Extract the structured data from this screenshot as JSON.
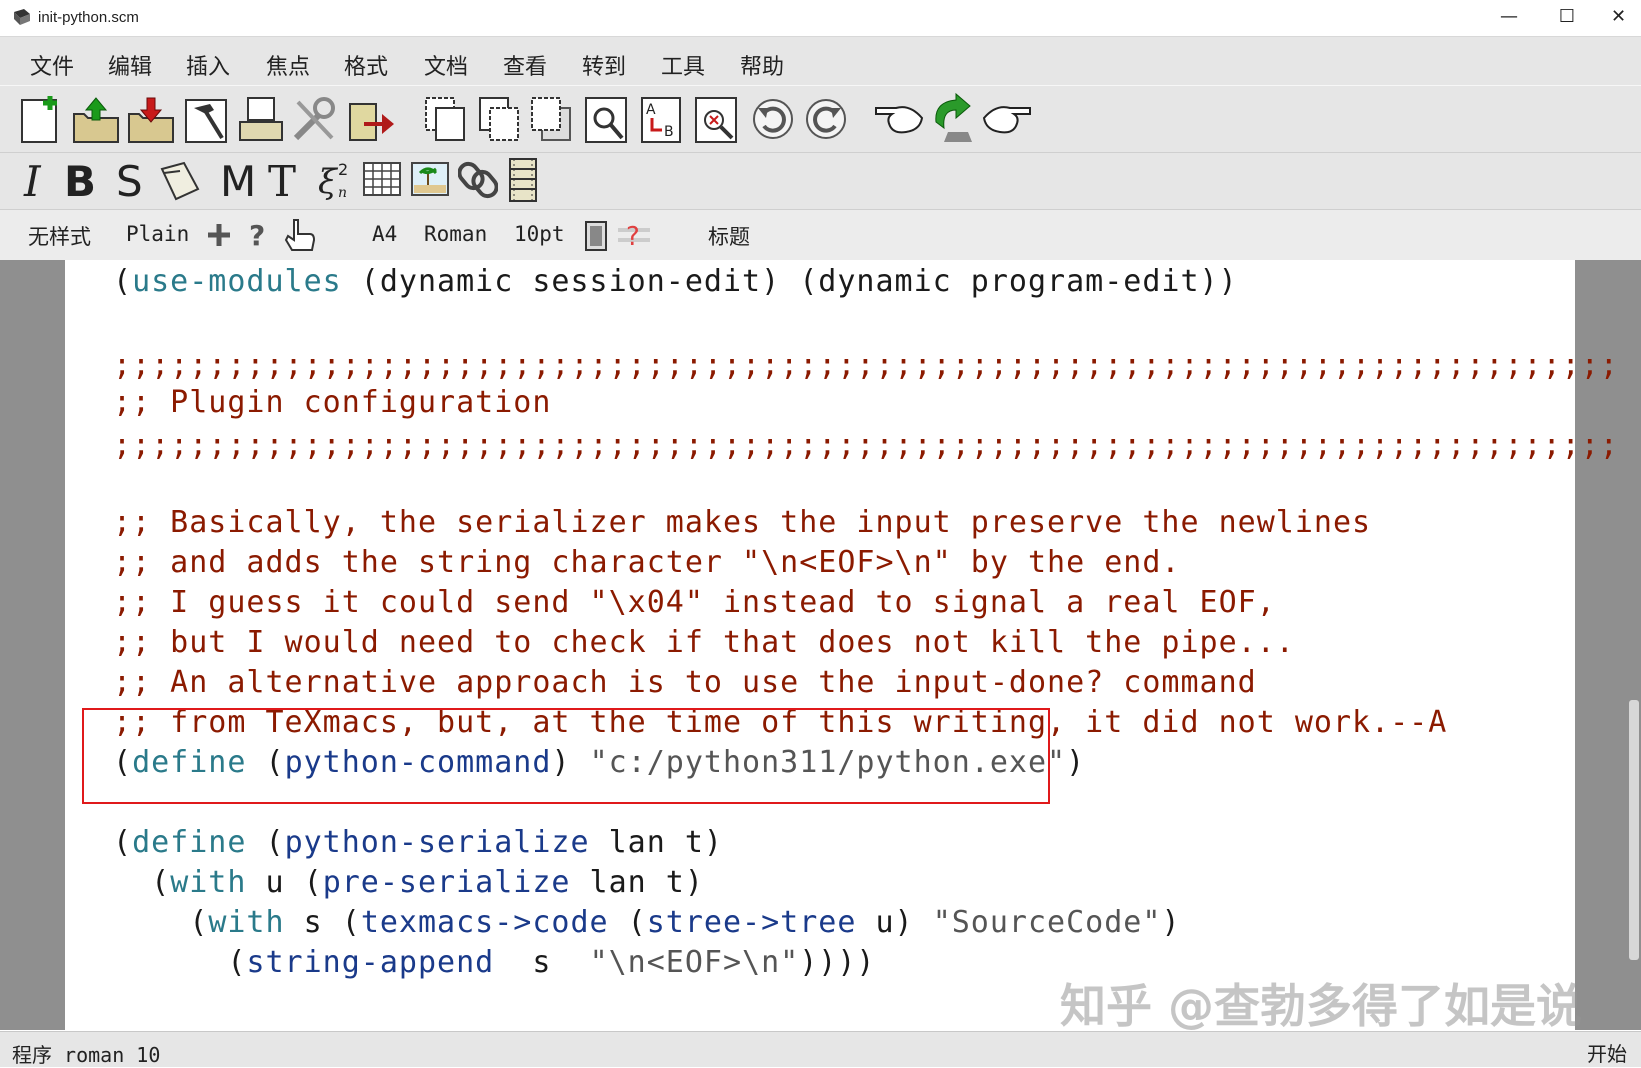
{
  "window": {
    "title": "init-python.scm",
    "minimize": "—",
    "maximize": "☐",
    "close": "✕"
  },
  "menu": [
    "文件",
    "编辑",
    "插入",
    "焦点",
    "格式",
    "文档",
    "查看",
    "转到",
    "工具",
    "帮助"
  ],
  "toolbar_format": {
    "italic": "I",
    "bold": "B",
    "sans": "S",
    "math": "M",
    "text": "T"
  },
  "toolbar_mode": {
    "style": "无样式",
    "language": "Plain",
    "paper": "A4",
    "font": "Roman",
    "size": "10pt",
    "title": "标题"
  },
  "code": {
    "line1": [
      {
        "t": "(",
        "c": "bl"
      },
      {
        "t": "use-modules",
        "c": "kw"
      },
      {
        "t": " (dynamic session-edit) (dynamic program-edit))",
        "c": "bl"
      }
    ],
    "line2": ";;;;;;;;;;;;;;;;;;;;;;;;;;;;;;;;;;;;;;;;;;;;;;;;;;;;;;;;;;;;;;;;;;;;;;;;;;;;;;;",
    "line3": ";; Plugin configuration",
    "line4": ";;;;;;;;;;;;;;;;;;;;;;;;;;;;;;;;;;;;;;;;;;;;;;;;;;;;;;;;;;;;;;;;;;;;;;;;;;;;;;;",
    "line5": ";; Basically, the serializer makes the input preserve the newlines",
    "line6": ";; and adds the string character \"\\n<EOF>\\n\" by the end.",
    "line7": ";; I guess it could send \"\\x04\" instead to signal a real EOF,",
    "line8": ";; but I would need to check if that does not kill the pipe...",
    "line9": ";; An alternative approach is to use the input-done? command",
    "line10": ";; from TeXmacs, but, at the time of this writing, it did not work.--A",
    "line11": [
      {
        "t": "(",
        "c": "bl"
      },
      {
        "t": "define",
        "c": "kw"
      },
      {
        "t": " (",
        "c": "bl"
      },
      {
        "t": "python-command",
        "c": "fn"
      },
      {
        "t": ") ",
        "c": "bl"
      },
      {
        "t": "\"c:/python311/python.exe\"",
        "c": "st"
      },
      {
        "t": ")",
        "c": "bl"
      }
    ],
    "line12": [
      {
        "t": "(",
        "c": "bl"
      },
      {
        "t": "define",
        "c": "kw"
      },
      {
        "t": " (",
        "c": "bl"
      },
      {
        "t": "python-serialize",
        "c": "fn"
      },
      {
        "t": " lan t)",
        "c": "bl"
      }
    ],
    "line13": [
      {
        "t": "  (",
        "c": "bl"
      },
      {
        "t": "with",
        "c": "kw"
      },
      {
        "t": " u (",
        "c": "bl"
      },
      {
        "t": "pre-serialize",
        "c": "fn"
      },
      {
        "t": " lan t)",
        "c": "bl"
      }
    ],
    "line14": [
      {
        "t": "    (",
        "c": "bl"
      },
      {
        "t": "with",
        "c": "kw"
      },
      {
        "t": " s (",
        "c": "bl"
      },
      {
        "t": "texmacs->code",
        "c": "fn"
      },
      {
        "t": " (",
        "c": "bl"
      },
      {
        "t": "stree->tree",
        "c": "fn"
      },
      {
        "t": " u) ",
        "c": "bl"
      },
      {
        "t": "\"SourceCode\"",
        "c": "st"
      },
      {
        "t": ")",
        "c": "bl"
      }
    ],
    "line15": [
      {
        "t": "      (",
        "c": "bl"
      },
      {
        "t": "string-append",
        "c": "fn"
      },
      {
        "t": "  s  ",
        "c": "bl"
      },
      {
        "t": "\"\\n<EOF>\\n\"",
        "c": "st"
      },
      {
        "t": "))))",
        "c": "bl"
      }
    ]
  },
  "watermark": "知乎 @查勃多得了如是说",
  "status": {
    "left": "程序 roman 10",
    "right": "开始"
  },
  "colors": {
    "comment": "#8b1a00",
    "keyword": "#2a7a8a",
    "function": "#1a3a8a",
    "string": "#555555",
    "highlight_box": "#e0191b"
  }
}
